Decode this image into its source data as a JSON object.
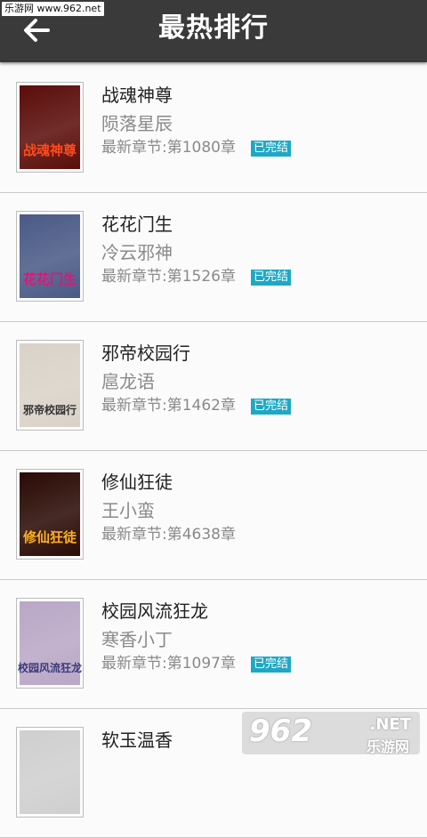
{
  "watermark_top": "乐游网 www.962.net",
  "header": {
    "title": "最热排行",
    "back_icon": "arrow-left-icon"
  },
  "books": [
    {
      "name": "战魂神尊",
      "author": "陨落星辰",
      "latest": "最新章节:第1080章",
      "status": "已完结",
      "cover_text": "战魂神尊",
      "cover_bg": "#5a0d0a",
      "cover_fg": "#ff4a1a"
    },
    {
      "name": "花花门生",
      "author": "冷云邪神",
      "latest": "最新章节:第1526章",
      "status": "已完结",
      "cover_text": "花花门生",
      "cover_bg": "#4a5a86",
      "cover_fg": "#e0147a"
    },
    {
      "name": "邪帝校园行",
      "author": "扈龙语",
      "latest": "最新章节:第1462章",
      "status": "已完结",
      "cover_text": "邪帝校园行",
      "cover_bg": "#d9d2c8",
      "cover_fg": "#333333"
    },
    {
      "name": "修仙狂徒",
      "author": "王小蛮",
      "latest": "最新章节:第4638章",
      "status": "",
      "cover_text": "修仙狂徒",
      "cover_bg": "#2a0a04",
      "cover_fg": "#ffb020"
    },
    {
      "name": "校园风流狂龙",
      "author": "寒香小丁",
      "latest": "最新章节:第1097章",
      "status": "已完结",
      "cover_text": "校园风流狂龙",
      "cover_bg": "#b9a7c6",
      "cover_fg": "#3b3b7a"
    },
    {
      "name": "软玉温香",
      "author": "",
      "latest": "",
      "status": "",
      "cover_text": "",
      "cover_bg": "#cfcfcf",
      "cover_fg": "#333333"
    }
  ],
  "watermark_bottom": {
    "big": "962",
    "small": ".NET",
    "small2": "乐游网"
  },
  "colors": {
    "header_bg": "#3a3a3a",
    "badge": "#1fa8c5"
  }
}
